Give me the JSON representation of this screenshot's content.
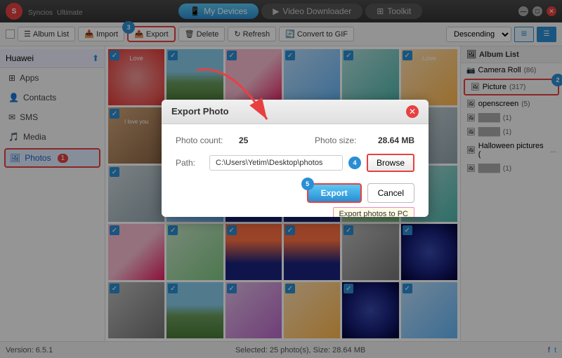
{
  "app": {
    "name": "Syncios",
    "edition": "Ultimate",
    "version": "6.5.1"
  },
  "titlebar": {
    "nav": [
      {
        "label": "My Devices",
        "active": true
      },
      {
        "label": "Video Downloader",
        "active": false
      },
      {
        "label": "Toolkit",
        "active": false
      }
    ],
    "window_buttons": [
      "minimize",
      "maximize",
      "close"
    ]
  },
  "toolbar": {
    "album_list": "Album List",
    "import": "Import",
    "export": "Export",
    "delete": "Delete",
    "refresh": "Refresh",
    "convert_gif": "Convert to GIF",
    "sort": "Descending"
  },
  "sidebar": {
    "device": "Huawei",
    "items": [
      {
        "label": "Apps",
        "icon": "apps-icon"
      },
      {
        "label": "Contacts",
        "icon": "contacts-icon"
      },
      {
        "label": "SMS",
        "icon": "sms-icon"
      },
      {
        "label": "Media",
        "icon": "media-icon"
      },
      {
        "label": "Photos",
        "icon": "photos-icon",
        "badge": "1",
        "active": true
      }
    ]
  },
  "album_panel": {
    "header": "Album List",
    "items": [
      {
        "label": "Camera Roll",
        "count": "(86)"
      },
      {
        "label": "Picture",
        "count": "(317)",
        "active": true
      },
      {
        "label": "openscreen",
        "count": "(5)"
      },
      {
        "label": "████",
        "count": "(1)"
      },
      {
        "label": "████",
        "count": "(1)"
      },
      {
        "label": "Halloween pictures (",
        "count": "..."
      },
      {
        "label": "████",
        "count": "(1)"
      }
    ]
  },
  "modal": {
    "title": "Export Photo",
    "photo_count_label": "Photo count:",
    "photo_count_value": "25",
    "photo_size_label": "Photo size:",
    "photo_size_value": "28.64 MB",
    "path_label": "Path:",
    "path_value": "C:\\Users\\Yetim\\Desktop\\photos",
    "browse_label": "Browse",
    "export_label": "Export",
    "cancel_label": "Cancel",
    "tooltip": "Export photos to PC"
  },
  "statusbar": {
    "version": "Version: 6.5.1",
    "selection": "Selected: 25 photo(s), Size: 28.64 MB"
  },
  "step_numbers": {
    "export_toolbar": "3",
    "album_picture": "2",
    "browse_field": "4",
    "export_modal": "5"
  }
}
